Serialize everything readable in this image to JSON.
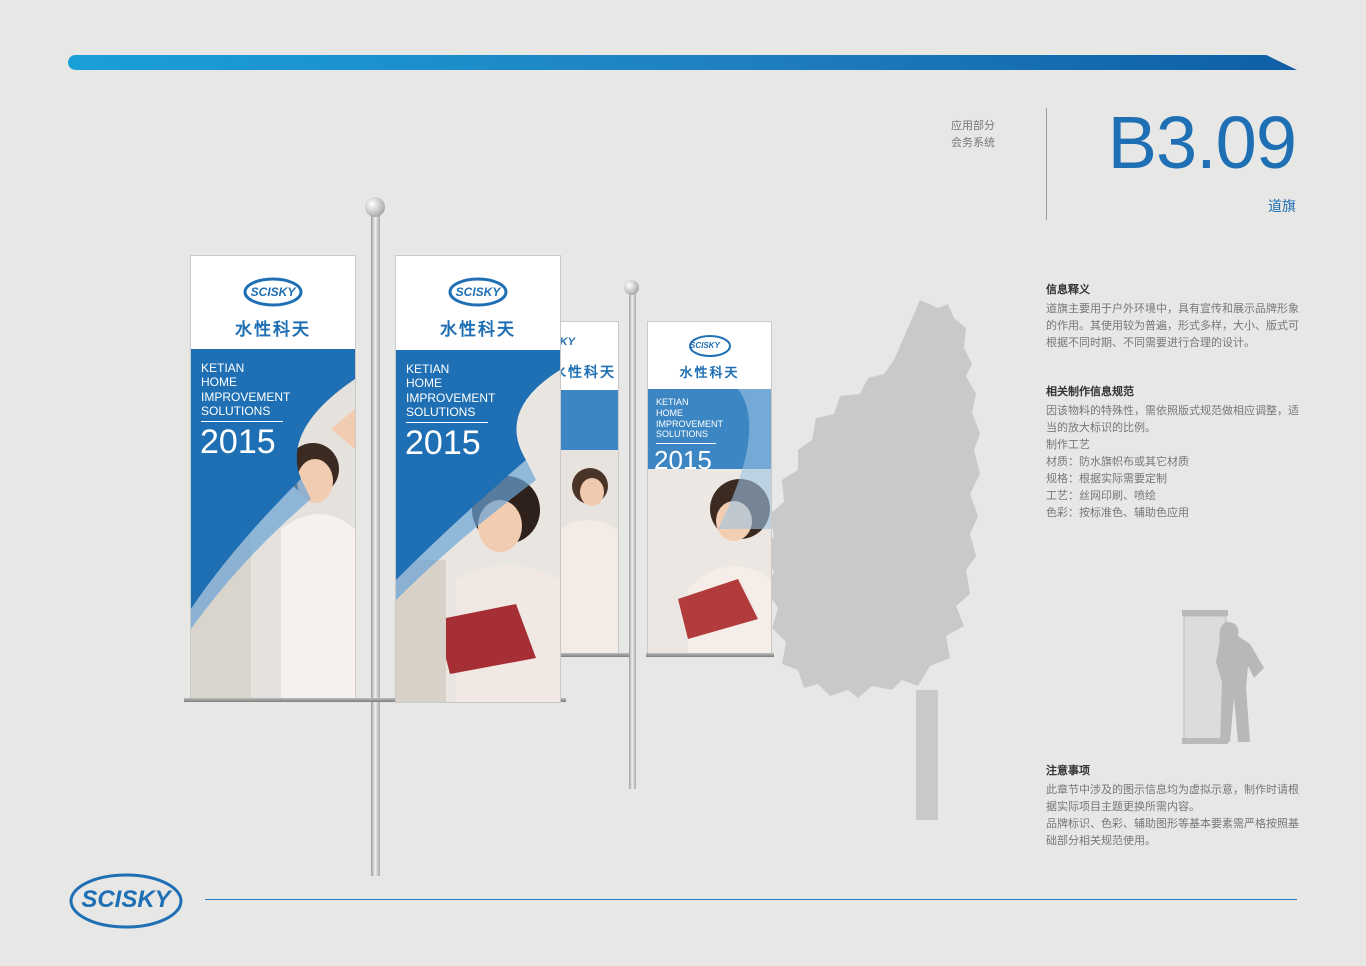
{
  "header": {
    "section": "应用部分",
    "subsection": "会务系统",
    "code": "B3.09",
    "title": "道旗"
  },
  "info_blocks": [
    {
      "heading": "信息释义",
      "lines": [
        "道旗主要用于户外环境中，具有宣传和展示品牌形象的作用。其使用较为普遍，形式多样，大小、版式可根据不同时期、不同需要进行合理的设计。"
      ]
    },
    {
      "heading": "相关制作信息规范",
      "lines": [
        "因该物料的特殊性，需依照版式规范做相应调整，适当的放大标识的比例。",
        "制作工艺",
        "材质：防水旗帜布或其它材质",
        "规格：根据实际需要定制",
        "工艺：丝网印刷、喷绘",
        "色彩：按标准色、辅助色应用"
      ]
    },
    {
      "heading": "注意事项",
      "lines": [
        "此章节中涉及的图示信息均为虚拟示意，制作时请根据实际项目主题更换所需内容。",
        "品牌标识、色彩、辅助图形等基本要素需严格按照基础部分相关规范使用。"
      ]
    }
  ],
  "banner": {
    "logo_text": "SCISKY",
    "brand_cn": "水性科天",
    "tagline": [
      "KETIAN",
      "HOME",
      "IMPROVEMENT",
      "SOLUTIONS"
    ],
    "year": "2015"
  },
  "footer": {
    "logo_text": "SCISKY"
  },
  "colors": {
    "brand_blue": "#1f6fb4",
    "accent_gradient_start": "#1aa0d8"
  }
}
